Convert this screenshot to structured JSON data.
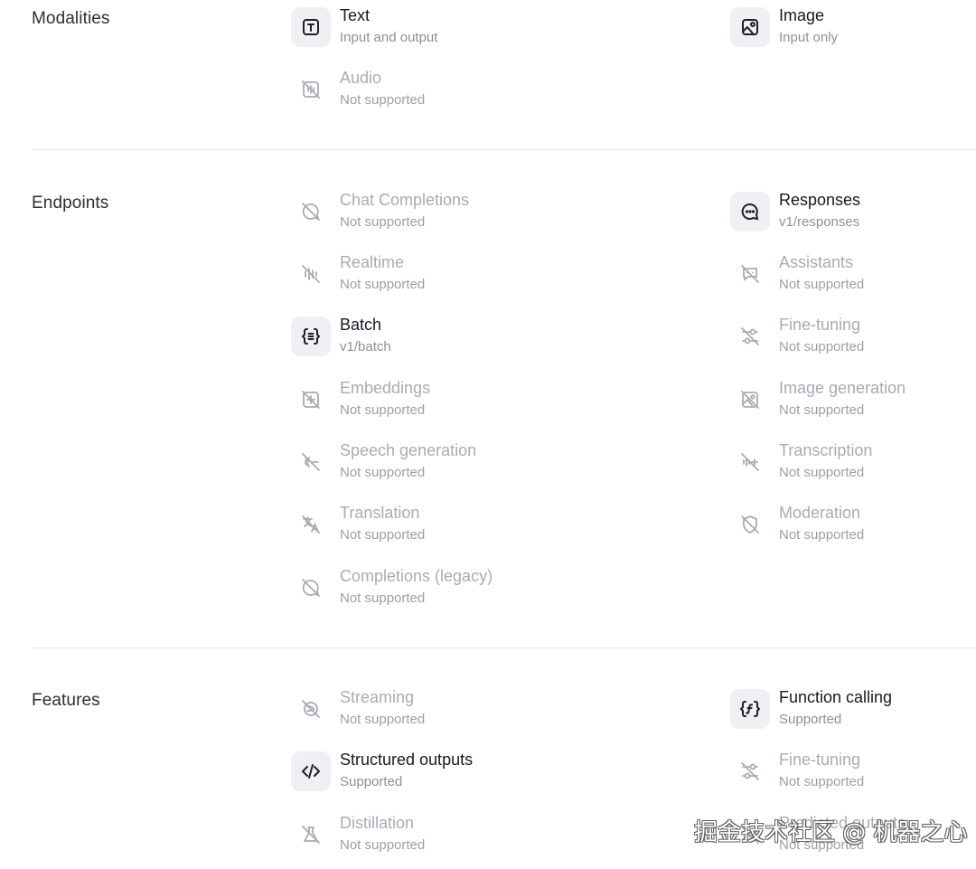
{
  "modalities": {
    "title": "Modalities",
    "items": [
      {
        "label": "Text",
        "sub": "Input and output",
        "icon": "text-icon",
        "supported": true
      },
      {
        "label": "Image",
        "sub": "Input only",
        "icon": "image-icon",
        "supported": true
      },
      {
        "label": "Audio",
        "sub": "Not supported",
        "icon": "audio-off-icon",
        "supported": false
      }
    ]
  },
  "endpoints": {
    "title": "Endpoints",
    "items": [
      {
        "label": "Chat Completions",
        "sub": "Not supported",
        "icon": "chat-off-icon",
        "supported": false
      },
      {
        "label": "Responses",
        "sub": "v1/responses",
        "icon": "chat-bubble-icon",
        "supported": true
      },
      {
        "label": "Realtime",
        "sub": "Not supported",
        "icon": "realtime-off-icon",
        "supported": false
      },
      {
        "label": "Assistants",
        "sub": "Not supported",
        "icon": "assistants-off-icon",
        "supported": false
      },
      {
        "label": "Batch",
        "sub": "v1/batch",
        "icon": "batch-braces-icon",
        "supported": true
      },
      {
        "label": "Fine-tuning",
        "sub": "Not supported",
        "icon": "fine-tuning-off-icon",
        "supported": false
      },
      {
        "label": "Embeddings",
        "sub": "Not supported",
        "icon": "embeddings-off-icon",
        "supported": false
      },
      {
        "label": "Image generation",
        "sub": "Not supported",
        "icon": "image-generation-off-icon",
        "supported": false
      },
      {
        "label": "Speech generation",
        "sub": "Not supported",
        "icon": "speech-off-icon",
        "supported": false
      },
      {
        "label": "Transcription",
        "sub": "Not supported",
        "icon": "transcription-off-icon",
        "supported": false
      },
      {
        "label": "Translation",
        "sub": "Not supported",
        "icon": "translation-off-icon",
        "supported": false
      },
      {
        "label": "Moderation",
        "sub": "Not supported",
        "icon": "moderation-off-icon",
        "supported": false
      },
      {
        "label": "Completions (legacy)",
        "sub": "Not supported",
        "icon": "completions-off-icon",
        "supported": false
      }
    ]
  },
  "features": {
    "title": "Features",
    "items": [
      {
        "label": "Streaming",
        "sub": "Not supported",
        "icon": "streaming-off-icon",
        "supported": false
      },
      {
        "label": "Function calling",
        "sub": "Supported",
        "icon": "function-icon",
        "supported": true
      },
      {
        "label": "Structured outputs",
        "sub": "Supported",
        "icon": "code-icon",
        "supported": true
      },
      {
        "label": "Fine-tuning",
        "sub": "Not supported",
        "icon": "fine-tuning-off-icon",
        "supported": false
      },
      {
        "label": "Distillation",
        "sub": "Not supported",
        "icon": "distillation-off-icon",
        "supported": false
      },
      {
        "label": "Predicted outputs",
        "sub": "Not supported",
        "icon": "predicted-off-icon",
        "supported": false
      }
    ]
  },
  "watermark": "掘金技术社区 @ 机器之心",
  "colors": {
    "active_icon_bg": "#eef0f3",
    "supported_text": "#16191e",
    "unsupported_text": "#a7acb4"
  }
}
